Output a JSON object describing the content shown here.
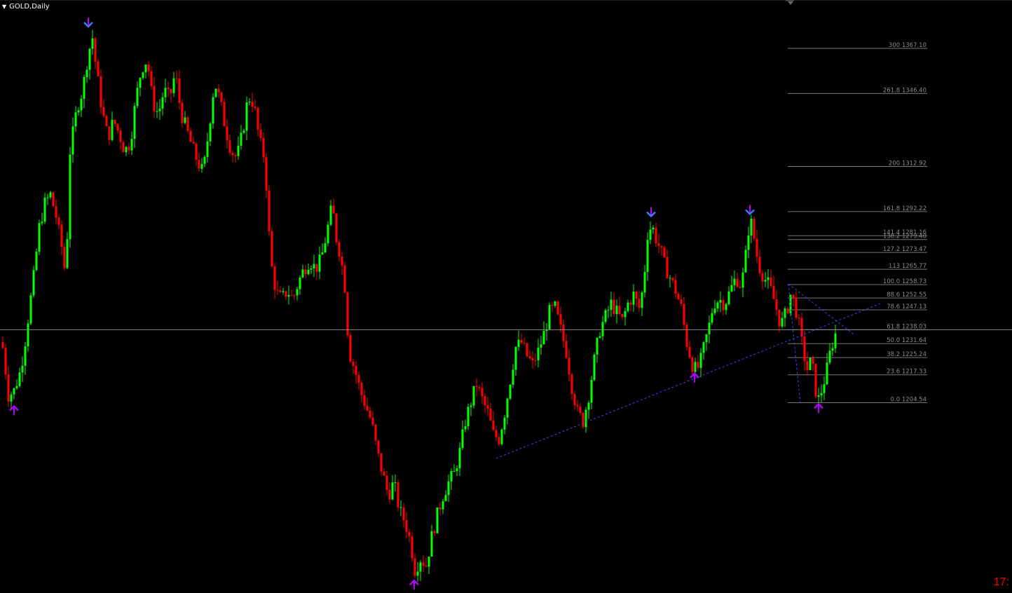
{
  "window": {
    "title": "GOLD,Daily"
  },
  "timer": {
    "text": "17:"
  },
  "colors": {
    "bull": "#00ff00",
    "bear": "#ff0000",
    "background": "#000000",
    "trend": "#4040ff",
    "fib": "#777777",
    "arrow_down": "#3a7bff",
    "arrow_up": "#b000ff"
  },
  "chart_data": {
    "type": "candlestick",
    "symbol": "GOLD",
    "timeframe": "Daily",
    "current_price_line": 1238.0,
    "fibonacci": [
      {
        "label": "300 1367.10",
        "level": 300,
        "price": 1367.1
      },
      {
        "label": "261.8 1346.40",
        "level": 261.8,
        "price": 1346.4
      },
      {
        "label": "200 1312.92",
        "level": 200,
        "price": 1312.92
      },
      {
        "label": "161.8 1292.22",
        "level": 161.8,
        "price": 1292.22
      },
      {
        "label": "141.4 1281.16",
        "level": 141.4,
        "price": 1281.16
      },
      {
        "label": "138.2 1279.40",
        "level": 138.2,
        "price": 1279.4
      },
      {
        "label": "127.2 1273.47",
        "level": 127.2,
        "price": 1273.47
      },
      {
        "label": "113 1265.77",
        "level": 113,
        "price": 1265.77
      },
      {
        "label": "100.0 1258.73",
        "level": 100.0,
        "price": 1258.73
      },
      {
        "label": "88.6 1252.55",
        "level": 88.6,
        "price": 1252.55
      },
      {
        "label": "78.6 1247.13",
        "level": 78.6,
        "price": 1247.13
      },
      {
        "label": "61.8 1238.03",
        "level": 61.8,
        "price": 1238.03
      },
      {
        "label": "50.0 1231.64",
        "level": 50.0,
        "price": 1231.64
      },
      {
        "label": "38.2 1225.24",
        "level": 38.2,
        "price": 1225.24
      },
      {
        "label": "23.6 1217.33",
        "level": 23.6,
        "price": 1217.33
      },
      {
        "label": "0.0 1204.54",
        "level": 0.0,
        "price": 1204.54
      }
    ],
    "price_path": [
      [
        0,
        1240
      ],
      [
        7,
        1222
      ],
      [
        12,
        1208
      ],
      [
        20,
        1210
      ],
      [
        28,
        1218
      ],
      [
        34,
        1228
      ],
      [
        40,
        1243
      ],
      [
        48,
        1262
      ],
      [
        56,
        1285
      ],
      [
        64,
        1296
      ],
      [
        72,
        1300
      ],
      [
        80,
        1290
      ],
      [
        88,
        1276
      ],
      [
        94,
        1262
      ],
      [
        100,
        1320
      ],
      [
        110,
        1340
      ],
      [
        118,
        1348
      ],
      [
        126,
        1365
      ],
      [
        132,
        1372
      ],
      [
        138,
        1356
      ],
      [
        146,
        1338
      ],
      [
        154,
        1326
      ],
      [
        162,
        1334
      ],
      [
        170,
        1328
      ],
      [
        178,
        1320
      ],
      [
        186,
        1324
      ],
      [
        194,
        1344
      ],
      [
        202,
        1358
      ],
      [
        210,
        1362
      ],
      [
        218,
        1342
      ],
      [
        226,
        1337
      ],
      [
        234,
        1348
      ],
      [
        242,
        1344
      ],
      [
        250,
        1356
      ],
      [
        258,
        1338
      ],
      [
        266,
        1330
      ],
      [
        274,
        1322
      ],
      [
        282,
        1315
      ],
      [
        290,
        1310
      ],
      [
        298,
        1330
      ],
      [
        306,
        1352
      ],
      [
        314,
        1343
      ],
      [
        322,
        1330
      ],
      [
        330,
        1320
      ],
      [
        338,
        1317
      ],
      [
        346,
        1328
      ],
      [
        354,
        1345
      ],
      [
        362,
        1342
      ],
      [
        370,
        1325
      ],
      [
        378,
        1316
      ],
      [
        386,
        1270
      ],
      [
        394,
        1255
      ],
      [
        402,
        1252
      ],
      [
        410,
        1256
      ],
      [
        418,
        1252
      ],
      [
        426,
        1260
      ],
      [
        434,
        1266
      ],
      [
        442,
        1270
      ],
      [
        450,
        1266
      ],
      [
        458,
        1270
      ],
      [
        466,
        1282
      ],
      [
        474,
        1295
      ],
      [
        480,
        1280
      ],
      [
        486,
        1272
      ],
      [
        492,
        1258
      ],
      [
        498,
        1228
      ],
      [
        506,
        1220
      ],
      [
        514,
        1210
      ],
      [
        522,
        1203
      ],
      [
        530,
        1196
      ],
      [
        538,
        1182
      ],
      [
        546,
        1172
      ],
      [
        554,
        1162
      ],
      [
        562,
        1168
      ],
      [
        570,
        1155
      ],
      [
        578,
        1150
      ],
      [
        586,
        1140
      ],
      [
        592,
        1128
      ],
      [
        600,
        1133
      ],
      [
        608,
        1130
      ],
      [
        616,
        1143
      ],
      [
        624,
        1153
      ],
      [
        632,
        1162
      ],
      [
        640,
        1168
      ],
      [
        648,
        1172
      ],
      [
        656,
        1182
      ],
      [
        664,
        1196
      ],
      [
        672,
        1205
      ],
      [
        680,
        1213
      ],
      [
        688,
        1206
      ],
      [
        696,
        1200
      ],
      [
        704,
        1190
      ],
      [
        712,
        1188
      ],
      [
        720,
        1200
      ],
      [
        728,
        1215
      ],
      [
        736,
        1230
      ],
      [
        744,
        1232
      ],
      [
        752,
        1226
      ],
      [
        760,
        1222
      ],
      [
        768,
        1228
      ],
      [
        776,
        1236
      ],
      [
        784,
        1246
      ],
      [
        792,
        1248
      ],
      [
        800,
        1238
      ],
      [
        808,
        1228
      ],
      [
        816,
        1212
      ],
      [
        824,
        1200
      ],
      [
        832,
        1196
      ],
      [
        840,
        1208
      ],
      [
        848,
        1224
      ],
      [
        856,
        1238
      ],
      [
        864,
        1244
      ],
      [
        872,
        1250
      ],
      [
        880,
        1246
      ],
      [
        888,
        1242
      ],
      [
        896,
        1250
      ],
      [
        904,
        1254
      ],
      [
        912,
        1248
      ],
      [
        918,
        1258
      ],
      [
        924,
        1282
      ],
      [
        930,
        1286
      ],
      [
        936,
        1280
      ],
      [
        942,
        1275
      ],
      [
        948,
        1268
      ],
      [
        956,
        1262
      ],
      [
        964,
        1256
      ],
      [
        972,
        1248
      ],
      [
        980,
        1232
      ],
      [
        988,
        1222
      ],
      [
        994,
        1219
      ],
      [
        1000,
        1224
      ],
      [
        1006,
        1232
      ],
      [
        1012,
        1240
      ],
      [
        1018,
        1250
      ],
      [
        1026,
        1252
      ],
      [
        1034,
        1250
      ],
      [
        1042,
        1256
      ],
      [
        1050,
        1262
      ],
      [
        1058,
        1258
      ],
      [
        1064,
        1272
      ],
      [
        1070,
        1290
      ],
      [
        1076,
        1280
      ],
      [
        1082,
        1268
      ],
      [
        1090,
        1262
      ],
      [
        1098,
        1258
      ],
      [
        1106,
        1250
      ],
      [
        1114,
        1240
      ],
      [
        1122,
        1246
      ],
      [
        1128,
        1254
      ],
      [
        1134,
        1250
      ],
      [
        1140,
        1240
      ],
      [
        1146,
        1228
      ],
      [
        1152,
        1220
      ],
      [
        1158,
        1224
      ],
      [
        1164,
        1210
      ],
      [
        1168,
        1206
      ],
      [
        1174,
        1212
      ],
      [
        1180,
        1220
      ],
      [
        1186,
        1230
      ],
      [
        1192,
        1236
      ]
    ],
    "signals": [
      {
        "type": "down",
        "x": 126,
        "price": 1379
      },
      {
        "type": "up",
        "x": 20,
        "price": 1201
      },
      {
        "type": "up",
        "x": 591,
        "price": 1121
      },
      {
        "type": "down",
        "x": 929,
        "price": 1292
      },
      {
        "type": "down",
        "x": 1070,
        "price": 1293
      },
      {
        "type": "up",
        "x": 991,
        "price": 1216
      },
      {
        "type": "up",
        "x": 1168,
        "price": 1202
      }
    ],
    "trendlines": [
      {
        "from": [
          708,
          1179
        ],
        "to": [
          1256,
          1250
        ]
      },
      {
        "from": [
          1125,
          1259
        ],
        "to": [
          1218,
          1236
        ]
      },
      {
        "from": [
          1125,
          1259
        ],
        "to": [
          1142,
          1204
        ]
      }
    ],
    "ylim": [
      1118.5,
      1388.0
    ],
    "grid": false
  }
}
